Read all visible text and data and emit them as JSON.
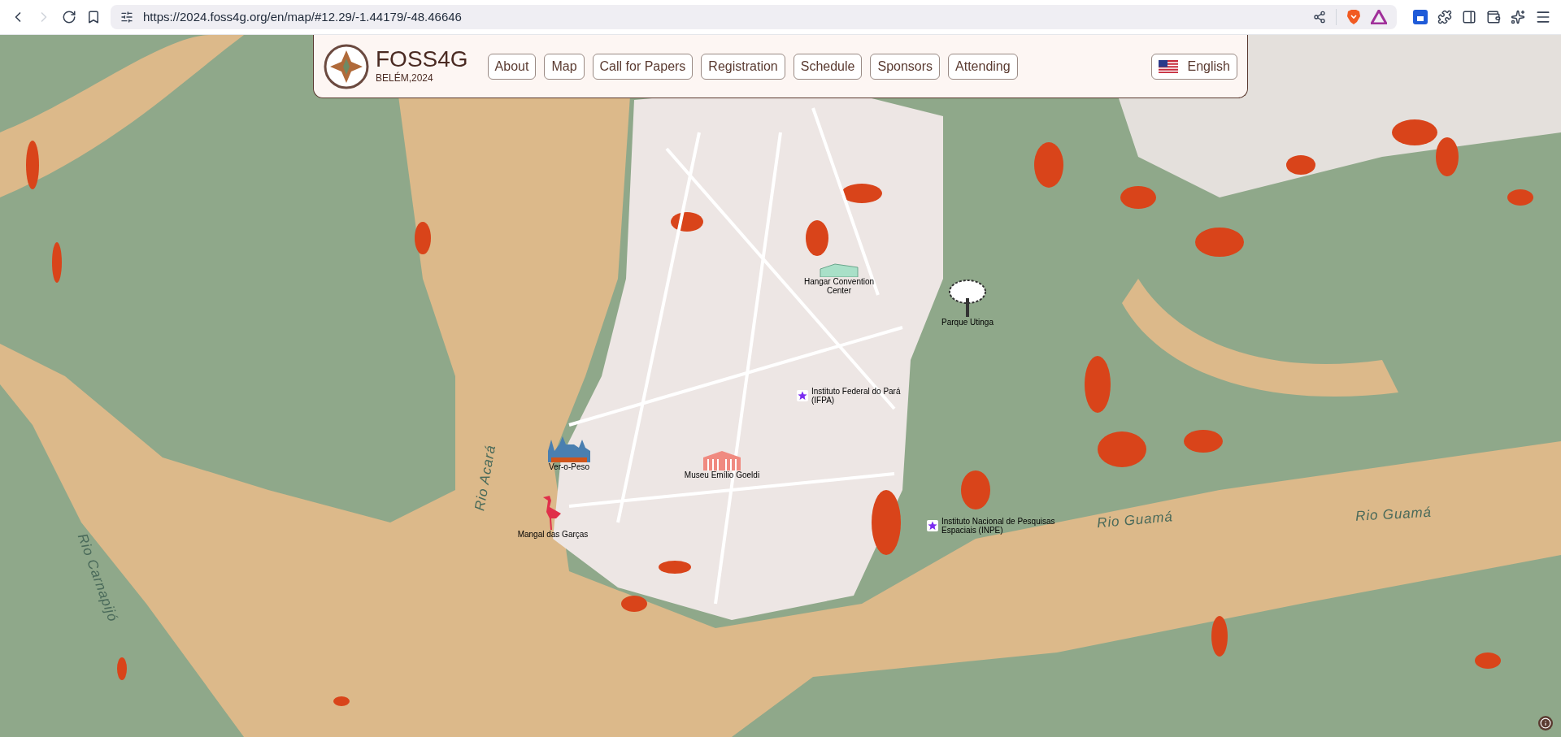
{
  "browser": {
    "url": "https://2024.foss4g.org/en/map/#12.29/-1.44179/-48.46646"
  },
  "header": {
    "logo_title": "FOSS4G",
    "logo_subtitle": "BELÉM,2024",
    "nav": [
      {
        "label": "About"
      },
      {
        "label": "Map"
      },
      {
        "label": "Call for Papers"
      },
      {
        "label": "Registration"
      },
      {
        "label": "Schedule"
      },
      {
        "label": "Sponsors"
      },
      {
        "label": "Attending"
      }
    ],
    "language": "English"
  },
  "map": {
    "places": [
      {
        "name": "Hangar Convention Center",
        "kind": "hangar"
      },
      {
        "name": "Parque Utinga",
        "kind": "tree"
      },
      {
        "name": "Instituto Federal do Pará (IFPA)",
        "kind": "star"
      },
      {
        "name": "Ver-o-Peso",
        "kind": "market"
      },
      {
        "name": "Museu Emílio Goeldi",
        "kind": "museum"
      },
      {
        "name": "Instituto Nacional de Pesquisas Espaciais (INPE)",
        "kind": "star"
      },
      {
        "name": "Mangal das Garças",
        "kind": "bird"
      }
    ],
    "water_labels": [
      "Rio Acará",
      "Rio Carnapijó",
      "Rio Guamá",
      "Rio Guamá"
    ]
  }
}
